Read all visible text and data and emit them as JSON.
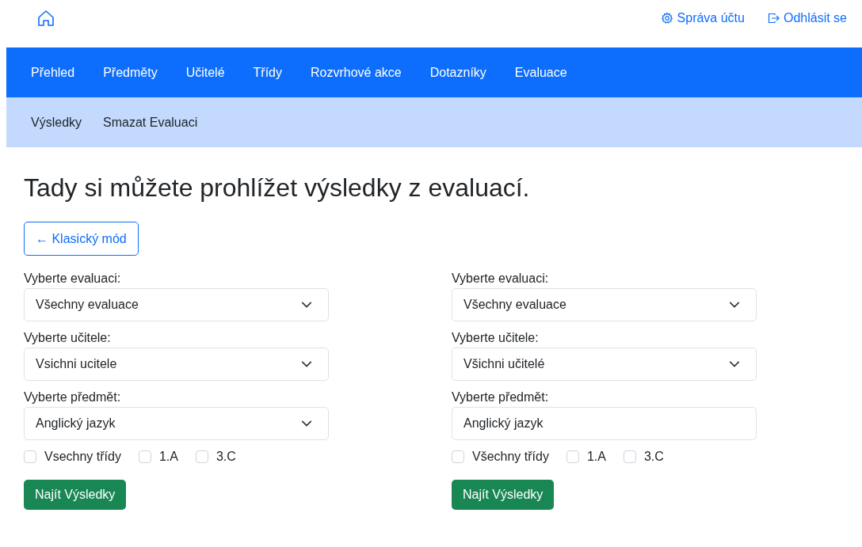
{
  "top_links": [
    {
      "kind": "settings",
      "label": "Správa účtu"
    },
    {
      "kind": "logout",
      "label": "Odhlásit se"
    }
  ],
  "nav": [
    {
      "label": "Přehled"
    },
    {
      "label": "Předměty"
    },
    {
      "label": "Učitelé"
    },
    {
      "label": "Třídy"
    },
    {
      "label": "Rozvrhové akce"
    },
    {
      "label": "Dotazníky"
    },
    {
      "label": "Evaluace"
    }
  ],
  "subnav": [
    {
      "label": "Výsledky"
    },
    {
      "label": "Smazat Evaluaci"
    }
  ],
  "heading": "Tady si můžete prohlížet výsledky z evaluací.",
  "mode_button": "← Klasický mód",
  "columns": [
    {
      "fields": [
        {
          "label": "Vyberte evaluaci:",
          "kind": "select",
          "value": "Všechny evaluace"
        },
        {
          "label": "Vyberte učitele:",
          "kind": "select",
          "value": "Vsichni ucitele"
        },
        {
          "label": "Vyberte předmět:",
          "kind": "select",
          "value": "Anglický jazyk"
        }
      ],
      "checkboxes": [
        {
          "label": "Vsechny třídy",
          "checked": false
        },
        {
          "label": "1.A",
          "checked": false
        },
        {
          "label": "3.C",
          "checked": false
        }
      ],
      "submit": "Najít Výsledky"
    },
    {
      "fields": [
        {
          "label": "Vyberte evaluaci:",
          "kind": "select",
          "value": "Všechny evaluace"
        },
        {
          "label": "Vyberte učitele:",
          "kind": "select",
          "value": "Všichni učitelé"
        },
        {
          "label": "Vyberte předmět:",
          "kind": "text",
          "value": "Anglický jazyk"
        }
      ],
      "checkboxes": [
        {
          "label": "Všechny třídy",
          "checked": false
        },
        {
          "label": "1.A",
          "checked": false
        },
        {
          "label": "3.C",
          "checked": false
        }
      ],
      "submit": "Najít Výsledky"
    }
  ]
}
